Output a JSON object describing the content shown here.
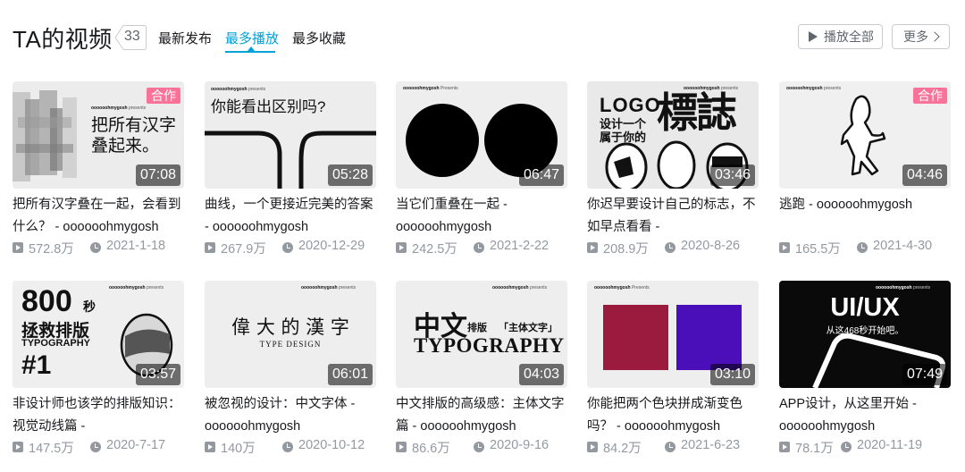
{
  "header": {
    "title": "TA的视频",
    "count": "33",
    "sort_tabs": [
      {
        "label": "最新发布",
        "active": false
      },
      {
        "label": "最多播放",
        "active": true
      },
      {
        "label": "最多收藏",
        "active": false
      }
    ],
    "play_all_label": "播放全部",
    "more_label": "更多"
  },
  "colors": {
    "accent": "#00a1d6",
    "coop_badge": "#fb7299",
    "meta_gray": "#9499a0"
  },
  "videos": [
    {
      "title": "把所有汉字叠在一起，会看到什么？ - oooooohmygosh",
      "duration": "07:08",
      "views": "572.8万",
      "date": "2021-1-18",
      "badge": "合作",
      "thumb_text": [
        "把所有汉字",
        "叠起来。"
      ],
      "brand": "oooooohmygosh",
      "brand_suffix": "presents"
    },
    {
      "title": "曲线，一个更接近完美的答案 - oooooohmygosh",
      "duration": "05:28",
      "views": "267.9万",
      "date": "2020-12-29",
      "thumb_text": [
        "你能看出区别吗?"
      ],
      "brand": "oooooohmygosh",
      "brand_suffix": "presents"
    },
    {
      "title": "当它们重叠在一起 - oooooohmygosh",
      "duration": "06:47",
      "views": "242.5万",
      "date": "2021-2-22",
      "brand": "oooooohmygosh",
      "brand_suffix": "Presents"
    },
    {
      "title": "你迟早要设计自己的标志，不如早点看看 -",
      "duration": "03:46",
      "views": "208.9万",
      "date": "2020-8-26",
      "thumb_text": [
        "LOGO",
        "设计一个",
        "属于你的",
        "標誌"
      ],
      "brand": "oooooohmygosh",
      "brand_suffix": "presents"
    },
    {
      "title": "逃跑 - oooooohmygosh",
      "duration": "04:46",
      "views": "165.5万",
      "date": "2021-4-30",
      "badge": "合作",
      "brand": "oooooohmygosh",
      "brand_suffix": "presents"
    },
    {
      "title": "非设计师也该学的排版知识：视觉动线篇 -",
      "duration": "03:57",
      "views": "147.5万",
      "date": "2020-7-17",
      "thumb_text": [
        "800",
        "秒",
        "拯救排版",
        "TYPOGRAPHY",
        "#1"
      ],
      "brand": "oooooohmygosh",
      "brand_suffix": "presents"
    },
    {
      "title": "被忽视的设计：中文字体 - oooooohmygosh",
      "duration": "06:01",
      "views": "140万",
      "date": "2020-10-12",
      "thumb_text": [
        "偉 大 的 漢 字",
        "TYPE DESIGN"
      ],
      "brand": "oooooohmygosh",
      "brand_suffix": "presents"
    },
    {
      "title": "中文排版的高级感：主体文字篇 - oooooohmygosh",
      "duration": "04:03",
      "views": "86.6万",
      "date": "2020-9-16",
      "thumb_text": [
        "中文",
        "排版",
        "「主体文字」",
        "TYPOGRAPHY"
      ],
      "brand": "oooooohmygosh",
      "brand_suffix": "presents"
    },
    {
      "title": "你能把两个色块拼成渐变色吗？ - oooooohmygosh",
      "duration": "03:10",
      "views": "84.2万",
      "date": "2021-6-23",
      "brand": "oooooohmygosh",
      "brand_suffix": "Presents",
      "swatches": [
        "#9b1b3f",
        "#4a0fb8"
      ]
    },
    {
      "title": "APP设计，从这里开始 - oooooohmygosh",
      "duration": "07:49",
      "views": "78.1万",
      "date": "2020-11-19",
      "thumb_text": [
        "UI/UX",
        "从这468秒开始吧。"
      ],
      "brand": "oooooohmygosh",
      "brand_suffix": "presents"
    }
  ]
}
